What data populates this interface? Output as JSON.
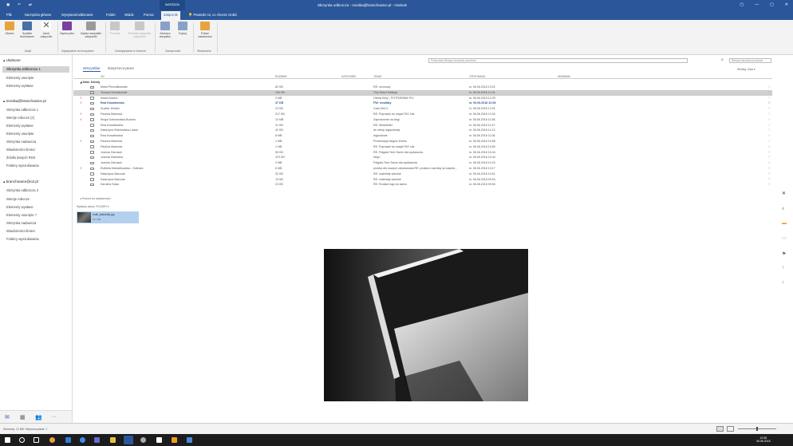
{
  "titlebar": {
    "title": "Skrzynka odbiorcza - monika@branchowice.pl - Outlook",
    "context_tab": "NARZĘDZIA",
    "qat_icons": [
      "save-icon",
      "undo-icon",
      "send-receive-icon"
    ],
    "win_buttons": [
      "▢",
      "—",
      "▢",
      "✕"
    ]
  },
  "tabs": [
    {
      "label": "Plik"
    },
    {
      "label": "Narzędzia główne"
    },
    {
      "label": "Wysyłanie/odbieranie"
    },
    {
      "label": "Folder"
    },
    {
      "label": "Widok"
    },
    {
      "label": "Pomoc"
    },
    {
      "label": "Załącznik"
    }
  ],
  "tellme": "Powiedz mi, co chcesz zrobić",
  "ribbon": {
    "buttons": [
      {
        "label": "Otwórz",
        "color": "#e8a33d"
      },
      {
        "label": "Szybkie drukowanie",
        "color": "#4a6fa5"
      },
      {
        "label": "Usuń załącznik",
        "color": "#555555"
      },
      {
        "label": "Zapisz jako",
        "color": "#7a3fa0"
      },
      {
        "label": "Zapisz wszystkie załączniki",
        "color": "#9a9a9a"
      },
      {
        "label": "Przekaż",
        "color": "#c8c8c8"
      },
      {
        "label": "Przekaż wszystkie załączniki",
        "color": "#c8c8c8"
      },
      {
        "label": "Zaznacz wszystko",
        "color": "#8aa0c8"
      },
      {
        "label": "Kopiuj",
        "color": "#8aa0c8"
      },
      {
        "label": "Pokaż wiadomość",
        "color": "#e8a33d"
      }
    ],
    "groups": [
      "Akcje",
      "Zapisywanie do komputera",
      "Udostępnianie w chmurze",
      "Zaznaczanie",
      "Wiadomość"
    ]
  },
  "folders": {
    "favorites_header": "Ulubione",
    "favorites": [
      {
        "label": "Skrzynka odbiorcza",
        "count": "1"
      },
      {
        "label": "Elementy usunięte",
        "count": ""
      },
      {
        "label": "Elementy wysłane",
        "count": ""
      }
    ],
    "account1_header": "monika@branchowice.pl",
    "account1": [
      {
        "label": "Skrzynka odbiorcza",
        "count": "1"
      },
      {
        "label": "Wersje robocze",
        "count": "[2]"
      },
      {
        "label": "Elementy wysłane",
        "count": ""
      },
      {
        "label": "Elementy usunięte",
        "count": ""
      },
      {
        "label": "Skrzynka nadawcza",
        "count": ""
      },
      {
        "label": "Wiadomości-śmieci",
        "count": ""
      },
      {
        "label": "Źródła danych RSS",
        "count": ""
      },
      {
        "label": "Foldery wyszukiwania",
        "count": ""
      }
    ],
    "account2_header": "branchowice@o2.pl",
    "account2": [
      {
        "label": "Skrzynka odbiorcza",
        "count": "3"
      },
      {
        "label": "Wersje robocze",
        "count": ""
      },
      {
        "label": "Elementy wysłane",
        "count": ""
      },
      {
        "label": "Elementy usunięte",
        "count": "7"
      },
      {
        "label": "Skrzynka nadawcza",
        "count": ""
      },
      {
        "label": "Wiadomości-śmieci",
        "count": ""
      },
      {
        "label": "Foldery wyszukiwania",
        "count": ""
      }
    ]
  },
  "nav_icons": [
    "mail-icon",
    "calendar-icon",
    "people-icon",
    "more-icon"
  ],
  "list": {
    "search_placeholder": "Przeszukaj: Bieżąca skrzynka pocztowa",
    "search_scope": "Bieżąca skrzynka pocztowa",
    "filter_all": "Wszystkie",
    "filter_unread": "Nieprzeczytane",
    "sort_by": "Według: Data ▾",
    "columns": [
      "OD",
      "ROZMIAR",
      "KATEGORIE",
      "TEMAT",
      "OTRZYMANO",
      "WZMIANKI"
    ],
    "group_header": "Data: Dzisiaj",
    "rows": [
      {
        "flag": "",
        "from": "Maria Pieczałkowska",
        "size": "82 KB",
        "subject": "RE: rozmowy",
        "date": "śr. 06.06.2018 13:02",
        "sel": false,
        "unread": false
      },
      {
        "flag": "",
        "from": "Tomasz Nowakowski",
        "size": "164 KB",
        "subject": "Tiny Data Holdings",
        "date": "śr. 06.06.2018 12:41",
        "sel": true,
        "unread": false
      },
      {
        "flag": "!",
        "from": "Kasia Nowicz",
        "size": "3 MB",
        "subject": "Oferta firmy - POTRZEBNE PIC",
        "date": "śr. 06.06.2018 12:29",
        "sel": false,
        "unread": false
      },
      {
        "flag": "!",
        "from": "Ewa Kowalewska",
        "size": "37 KB",
        "subject": "FW: rezultaty",
        "date": "śr. 06.06.2018 12:08",
        "sel": false,
        "unread": true
      },
      {
        "flag": "",
        "from": "Krystal Jelnicki",
        "size": "22 KB",
        "subject": "Czat (Kto?)",
        "date": "śr. 06.06.2018 12:01",
        "sel": false,
        "unread": false
      },
      {
        "flag": "!",
        "from": "Paulina Marenda",
        "size": "217 KB",
        "subject": "RE: Poprawki do mapki RIO Lite",
        "date": "śr. 06.06.2018 12:00",
        "sel": false,
        "unread": false
      },
      {
        "flag": "!",
        "from": "Kinga Dobrowolska-Bucheo",
        "size": "10 MB",
        "subject": "Zaproszenie na targi",
        "date": "śr. 06.06.2018 11:58",
        "sel": false,
        "unread": false
      },
      {
        "flag": "",
        "from": "Ewa Kowalewska",
        "size": "21 KB",
        "subject": "RE: Newsletter",
        "date": "śr. 06.06.2018 11:47",
        "sel": false,
        "unread": false
      },
      {
        "flag": "",
        "from": "Katarzyna Wiśniewska-Lasek",
        "size": "42 KB",
        "subject": "do oferty wyjazdowej",
        "date": "śr. 06.06.2018 11:13",
        "sel": false,
        "unread": false
      },
      {
        "flag": "",
        "from": "Ewa Kowalewska",
        "size": "8 MB",
        "subject": "wyjazdowe",
        "date": "śr. 06.06.2018 11:06",
        "sel": false,
        "unread": false
      },
      {
        "flag": "!",
        "from": "Paulina Marenda",
        "size": "1 MB",
        "subject": "Prezentacja targów Dzieło",
        "date": "śr. 06.06.2018 10:58",
        "sel": false,
        "unread": false
      },
      {
        "flag": "",
        "from": "Paulina Marenda",
        "size": "1 MB",
        "subject": "RE: Poprawki do mapki RIO Lite",
        "date": "śr. 06.06.2018 10:50",
        "sel": false,
        "unread": false
      },
      {
        "flag": "",
        "from": "Joanna Gierasch",
        "size": "55 KB",
        "subject": "RE: Półgala Tech Saver dla wydawców",
        "date": "śr. 06.06.2018 10:44",
        "sel": false,
        "unread": false
      },
      {
        "flag": "",
        "from": "Joanna Zalewska",
        "size": "370 KB",
        "subject": "Wspr.",
        "date": "śr. 06.06.2018 10:44",
        "sel": false,
        "unread": false
      },
      {
        "flag": "",
        "from": "Joanna Gierasch",
        "size": "2 MB",
        "subject": "Półgala Tech Saver dla wydawców",
        "date": "śr. 06.06.2018 10:23",
        "sel": false,
        "unread": false
      },
      {
        "flag": "!",
        "from": "Elżbieta Michalikowska - Gałecka",
        "size": "6 MB",
        "subject": "prośba dla nowych członkostwa RE: prośba o karotkę do kapela...",
        "date": "śr. 06.06.2018 10:17",
        "sel": false,
        "unread": false
      },
      {
        "flag": "",
        "from": "Katarzyna Marczak",
        "size": "32 KB",
        "subject": "RE: materiały szkolne",
        "date": "śr. 06.06.2018 10:01",
        "sel": false,
        "unread": false
      },
      {
        "flag": "",
        "from": "Katarzyna Marczak",
        "size": "19 KB",
        "subject": "RE: materiały szkolne",
        "date": "śr. 06.06.2018 09:54",
        "sel": false,
        "unread": false
      },
      {
        "flag": "",
        "from": "Karolina Stasz",
        "size": "23 KB",
        "subject": "RE: Rodział logo do startu",
        "date": "śr. 06.06.2018 09:53",
        "sel": false,
        "unread": false
      }
    ],
    "reply_hint": "Powrót do wiadomości",
    "attach_line": "Wysłany obraz:  FOLDER ▾",
    "attachment": {
      "name": "multi_statuetka.jpg",
      "size": "377 KB"
    }
  },
  "right_rail_icons": [
    "close-icon",
    "zoom-icon",
    "folder-icon",
    "move-icon",
    "flag-icon",
    "up-arrow-icon",
    "down-arrow-icon"
  ],
  "status": {
    "items": "Elementy: 12 890",
    "unread": "Nieprzeczytane: 1"
  },
  "taskbar": {
    "time": "12:08",
    "date": "06.06.2018",
    "colors": [
      "#ffffff",
      "#ffffff",
      "#ffffff",
      "#e8a33d",
      "#2d7fd3",
      "#3d8ee8",
      "#6a6acd",
      "#2b579a",
      "#aaaaaa",
      "#ffffff",
      "#f29b21",
      "#d04020",
      "#4a8ad8"
    ]
  }
}
